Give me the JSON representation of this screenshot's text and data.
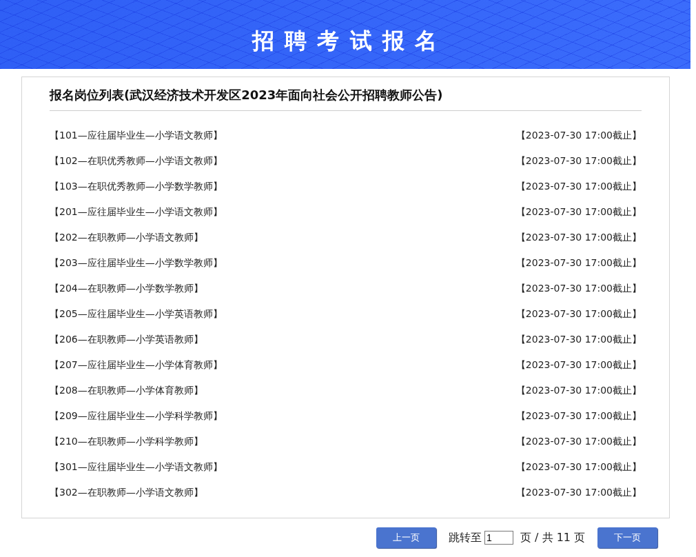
{
  "banner": {
    "title": "招 聘 考 试 报 名"
  },
  "list": {
    "title": "报名岗位列表(武汉经济技术开发区2023年面向社会公开招聘教师公告)",
    "items": [
      {
        "position": "【101—应往届毕业生—小学语文教师】",
        "deadline": "【2023-07-30 17:00截止】"
      },
      {
        "position": "【102—在职优秀教师—小学语文教师】",
        "deadline": "【2023-07-30 17:00截止】"
      },
      {
        "position": "【103—在职优秀教师—小学数学教师】",
        "deadline": "【2023-07-30 17:00截止】"
      },
      {
        "position": "【201—应往届毕业生—小学语文教师】",
        "deadline": "【2023-07-30 17:00截止】"
      },
      {
        "position": "【202—在职教师—小学语文教师】",
        "deadline": "【2023-07-30 17:00截止】"
      },
      {
        "position": "【203—应往届毕业生—小学数学教师】",
        "deadline": "【2023-07-30 17:00截止】"
      },
      {
        "position": "【204—在职教师—小学数学教师】",
        "deadline": "【2023-07-30 17:00截止】"
      },
      {
        "position": "【205—应往届毕业生—小学英语教师】",
        "deadline": "【2023-07-30 17:00截止】"
      },
      {
        "position": "【206—在职教师—小学英语教师】",
        "deadline": "【2023-07-30 17:00截止】"
      },
      {
        "position": "【207—应往届毕业生—小学体育教师】",
        "deadline": "【2023-07-30 17:00截止】"
      },
      {
        "position": "【208—在职教师—小学体育教师】",
        "deadline": "【2023-07-30 17:00截止】"
      },
      {
        "position": "【209—应往届毕业生—小学科学教师】",
        "deadline": "【2023-07-30 17:00截止】"
      },
      {
        "position": "【210—在职教师—小学科学教师】",
        "deadline": "【2023-07-30 17:00截止】"
      },
      {
        "position": "【301—应往届毕业生—小学语文教师】",
        "deadline": "【2023-07-30 17:00截止】"
      },
      {
        "position": "【302—在职教师—小学语文教师】",
        "deadline": "【2023-07-30 17:00截止】"
      }
    ]
  },
  "pagination": {
    "prev": "上一页",
    "jump_label": "跳转至",
    "page_value": "1",
    "total": "页 / 共 11 页",
    "next": "下一页"
  }
}
